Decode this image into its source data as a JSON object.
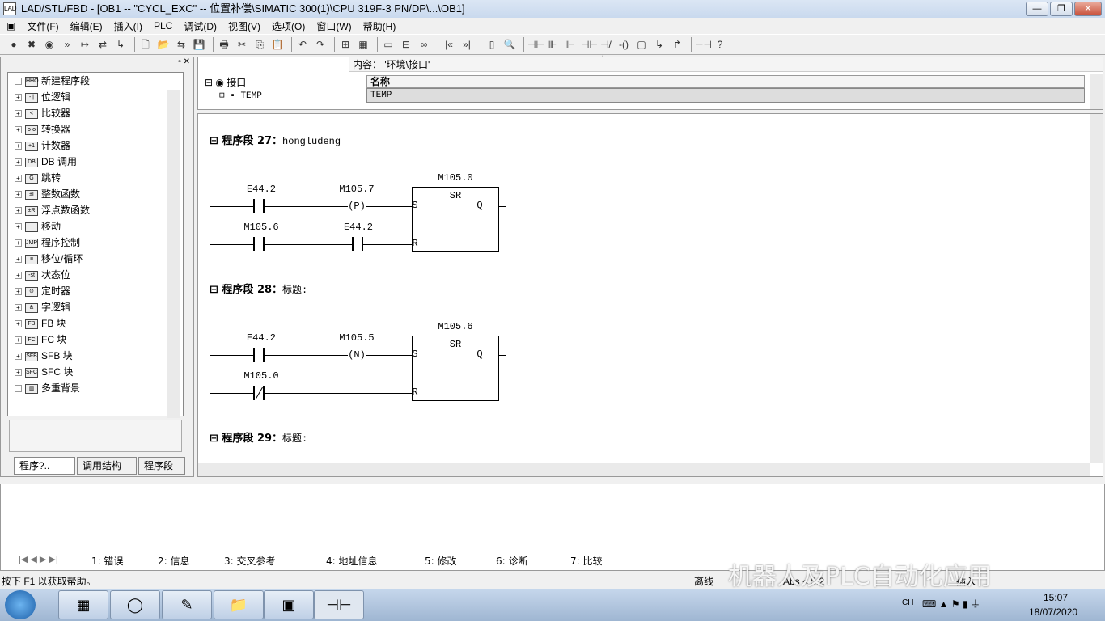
{
  "window": {
    "title": "LAD/STL/FBD  - [OB1 -- \"CYCL_EXC\" -- 位置补偿\\SIMATIC 300(1)\\CPU 319F-3 PN/DP\\...\\OB1]",
    "min": "—",
    "max": "❐",
    "close": "✕"
  },
  "menu": [
    "文件(F)",
    "编辑(E)",
    "插入(I)",
    "PLC",
    "调试(D)",
    "视图(V)",
    "选项(O)",
    "窗口(W)",
    "帮助(H)"
  ],
  "toolbar": [
    "●",
    "✖",
    "◉",
    "»",
    "↦",
    "⇄",
    "↳",
    "🗋",
    "📂",
    "⇆",
    "💾",
    "🖶",
    "✂",
    "⎘",
    "📋",
    "↶",
    "↷",
    "⊞",
    "▦",
    "▭",
    "⊟",
    "∞",
    "|«",
    "»|",
    "▯",
    "🔍",
    "⊣⊢",
    "⊪",
    "⊩",
    "⊣⊢",
    "⊣/⊢",
    "-()",
    "▢",
    "↳",
    "↱",
    "⊢⊣",
    "?"
  ],
  "sidebar": {
    "items": [
      {
        "label": "新建程序段",
        "icon": "HHO"
      },
      {
        "label": "位逻辑",
        "icon": "-||"
      },
      {
        "label": "比较器",
        "icon": "<"
      },
      {
        "label": "转换器",
        "icon": "o-o"
      },
      {
        "label": "计数器",
        "icon": "+1"
      },
      {
        "label": "DB 调用",
        "icon": "DB"
      },
      {
        "label": "跳转",
        "icon": "G"
      },
      {
        "label": "整数函数",
        "icon": "±I"
      },
      {
        "label": "浮点数函数",
        "icon": "±R"
      },
      {
        "label": "移动",
        "icon": "~"
      },
      {
        "label": "程序控制",
        "icon": "JMP"
      },
      {
        "label": "移位/循环",
        "icon": "≡"
      },
      {
        "label": "状态位",
        "icon": "-st"
      },
      {
        "label": "定时器",
        "icon": "⊙"
      },
      {
        "label": "字逻辑",
        "icon": "&"
      },
      {
        "label": "FB 块",
        "icon": "FB"
      },
      {
        "label": "FC 块",
        "icon": "FC"
      },
      {
        "label": "SFB 块",
        "icon": "SFB"
      },
      {
        "label": "SFC 块",
        "icon": "SFC"
      },
      {
        "label": "多重背景",
        "icon": "▥"
      }
    ],
    "tabs": [
      "程序?..",
      "调用结构",
      "程序段"
    ]
  },
  "interface": {
    "content_label": "内容：  '环境\\接口'",
    "root": "接口",
    "child": "TEMP",
    "col_name": "名称",
    "row": "TEMP"
  },
  "networks": [
    {
      "title": "程序段  27：",
      "comment": "honglude​ng",
      "box": "SR",
      "box_addr": "M105.0",
      "c1": "E44.2",
      "coil": "P",
      "coil_addr": "M105.7",
      "c2": "M105.6",
      "c3": "E44.2",
      "nc": false
    },
    {
      "title": "程序段  28：",
      "comment": "标题:",
      "box": "SR",
      "box_addr": "M105.6",
      "c1": "E44.2",
      "coil": "N",
      "coil_addr": "M105.5",
      "c2": "M105.0",
      "c3": "",
      "nc": true
    },
    {
      "title": "程序段  29：",
      "comment": "标题:"
    }
  ],
  "pins": {
    "s": "S",
    "r": "R",
    "q": "Q"
  },
  "output_tabs": [
    "1: 错误",
    "2: 信息",
    "3: 交叉参考",
    "4: 地址信息",
    "5: 修改",
    "6: 诊断",
    "7: 比较"
  ],
  "status": {
    "help": "按下 F1 以获取帮助。",
    "mode": "离线",
    "abs": "Abs < 5.2",
    "insert": "插入"
  },
  "tray": {
    "lang": "CH",
    "time": "15:07",
    "date": "18/07/2020"
  },
  "watermark": "机器人及PLC自动化应用"
}
